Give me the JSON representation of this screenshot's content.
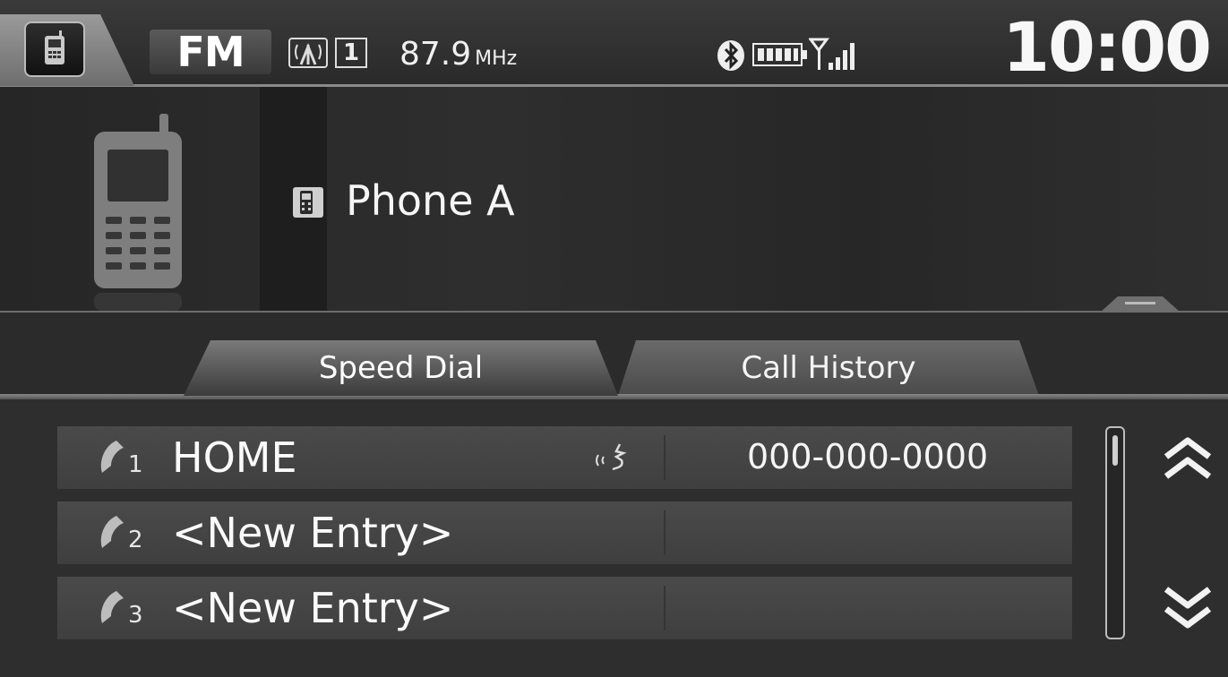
{
  "status_bar": {
    "source": "FM",
    "preset": "1",
    "frequency": "87.9",
    "frequency_unit": "MHz",
    "clock": "10:00",
    "icons": [
      "phone-icon",
      "antenna-icon",
      "bluetooth-icon",
      "battery-icon",
      "signal-icon"
    ]
  },
  "device": {
    "name": "Phone A",
    "icon": "phone-icon"
  },
  "tabs": [
    {
      "label": "Speed Dial",
      "selected": true
    },
    {
      "label": "Call History",
      "selected": false
    }
  ],
  "speed_dial": [
    {
      "index": "1",
      "label": "HOME",
      "voice_tag": true,
      "number": "000-000-0000"
    },
    {
      "index": "2",
      "label": "<New Entry>",
      "voice_tag": false,
      "number": ""
    },
    {
      "index": "3",
      "label": "<New Entry>",
      "voice_tag": false,
      "number": ""
    }
  ],
  "colors": {
    "background": "#2b2b2b",
    "row": "#444444",
    "text": "#f2f2f2"
  }
}
